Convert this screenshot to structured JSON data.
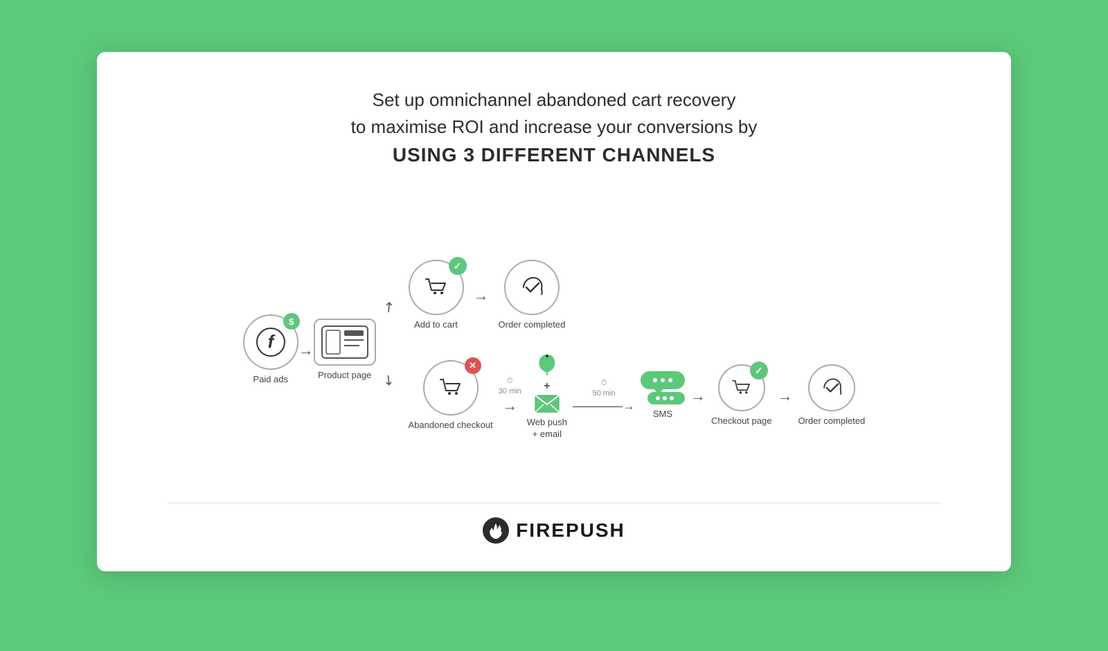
{
  "background": {
    "color": "#5cc87a"
  },
  "card": {
    "headline_line1": "Set up omnichannel abandoned cart recovery",
    "headline_line2": "to maximise ROI and increase your conversions by",
    "headline_bold": "USING 3 DIFFERENT CHANNELS"
  },
  "flow": {
    "paid_ads_label": "Paid ads",
    "product_page_label": "Product page",
    "add_to_cart_label": "Add to cart",
    "order_completed_top_label": "Order completed",
    "abandoned_checkout_label": "Abandoned checkout",
    "time1_label": "30 min",
    "web_push_email_label": "Web push\n+ email",
    "time2_label": "50 min",
    "sms_label": "SMS",
    "checkout_page_label": "Checkout page",
    "order_completed_bottom_label": "Order completed"
  },
  "footer": {
    "logo_text": "FIREPUSH"
  }
}
